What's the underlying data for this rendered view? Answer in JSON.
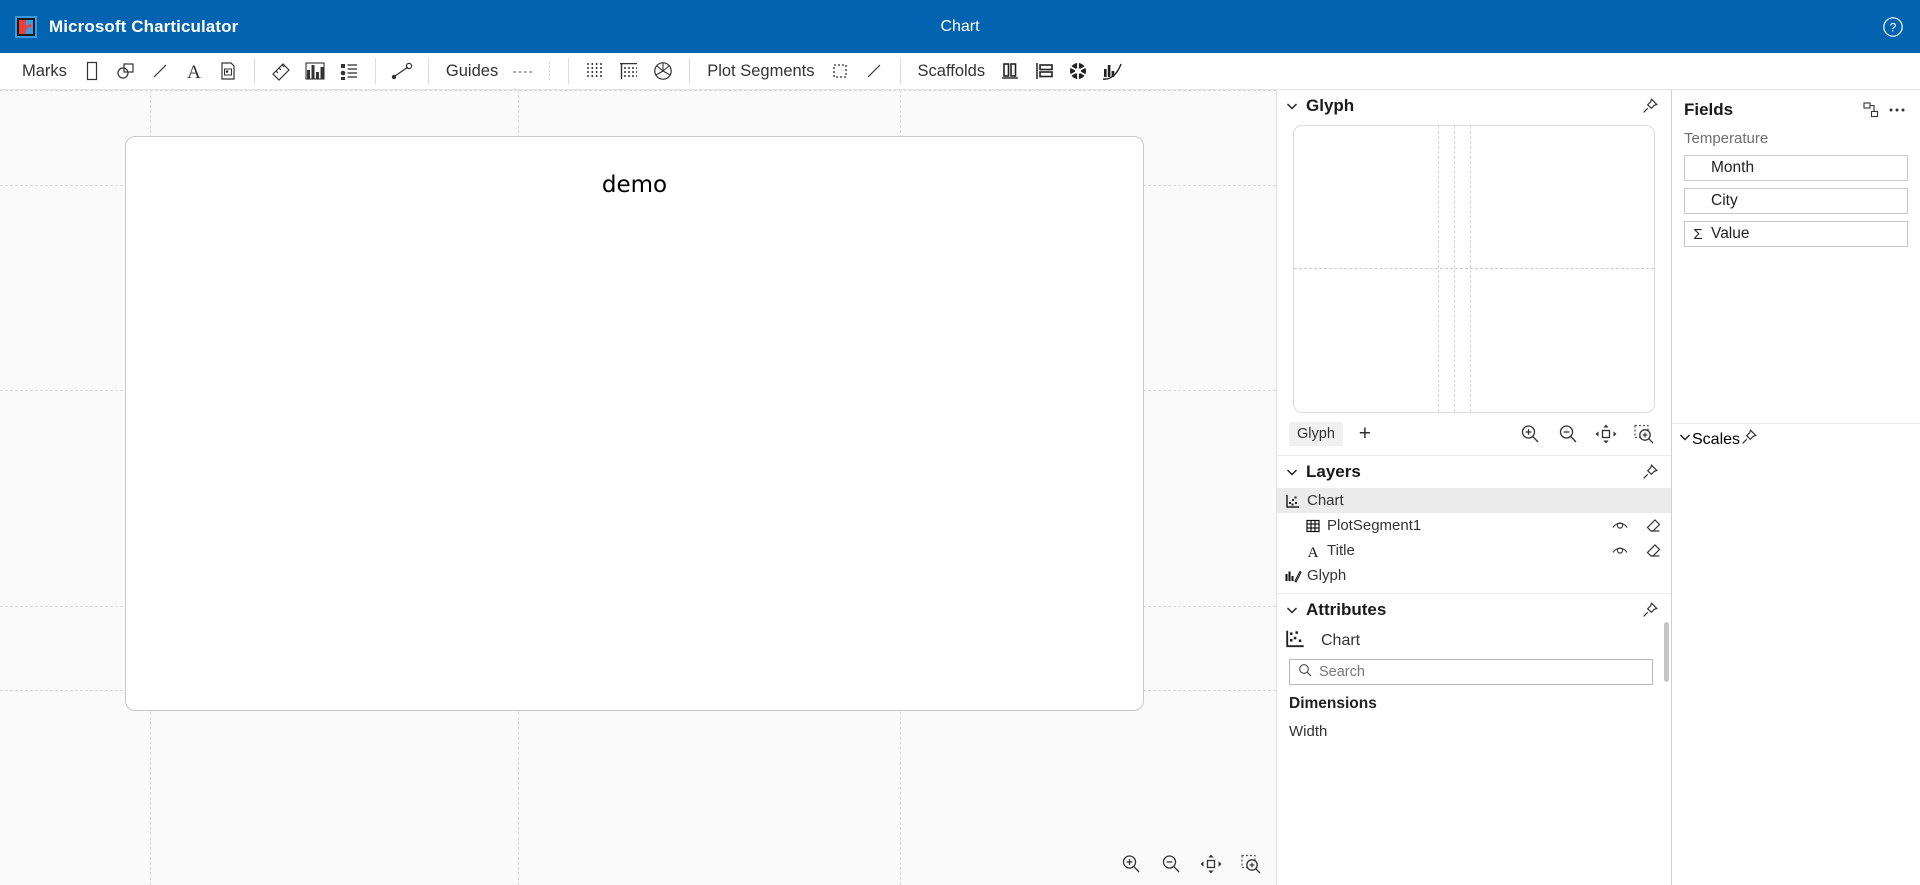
{
  "app": {
    "name": "Microsoft Charticulator",
    "logo_icon": "charticulator-logo",
    "center_title": "Chart",
    "help_icon": "help-circle-icon"
  },
  "toolbar": {
    "groups": [
      {
        "label": "Marks",
        "items": [
          {
            "icon": "rectangle-mark-icon",
            "name": "mark-rectangle"
          },
          {
            "icon": "symbol-mark-icon",
            "name": "mark-symbol"
          },
          {
            "icon": "line-mark-icon",
            "name": "mark-line"
          },
          {
            "icon": "text-mark-icon",
            "name": "mark-text"
          },
          {
            "icon": "image-mark-icon",
            "name": "mark-image"
          }
        ]
      },
      {
        "label": "",
        "items": [
          {
            "icon": "ruler-icon",
            "name": "mark-data-axis"
          },
          {
            "icon": "nested-chart-icon",
            "name": "mark-nested-chart"
          },
          {
            "icon": "legend-icon",
            "name": "mark-legend"
          }
        ]
      },
      {
        "label": "",
        "items": [
          {
            "icon": "link-icon",
            "name": "mark-link"
          }
        ]
      },
      {
        "label": "Guides",
        "items": [
          {
            "icon": "guide-line-icon",
            "name": "guide-line"
          },
          {
            "icon": "guide-coordinator-icon",
            "name": "guide-coordinator"
          }
        ]
      },
      {
        "label": "",
        "items": [
          {
            "icon": "guide-x-icon",
            "name": "guide-x"
          },
          {
            "icon": "guide-y-icon",
            "name": "guide-y"
          },
          {
            "icon": "guide-polar-icon",
            "name": "guide-polar"
          }
        ]
      },
      {
        "label": "Plot Segments",
        "items": [
          {
            "icon": "plot-segment-region-icon",
            "name": "plot-segment-2d"
          },
          {
            "icon": "plot-segment-line-icon",
            "name": "plot-segment-line"
          }
        ]
      },
      {
        "label": "Scaffolds",
        "items": [
          {
            "icon": "scaffold-cartesian-x-icon",
            "name": "scaffold-cartesian-x"
          },
          {
            "icon": "scaffold-cartesian-y-icon",
            "name": "scaffold-cartesian-y"
          },
          {
            "icon": "scaffold-polar-icon",
            "name": "scaffold-polar"
          },
          {
            "icon": "scaffold-curve-icon",
            "name": "scaffold-curve"
          }
        ]
      }
    ]
  },
  "canvas": {
    "chart_title": "demo",
    "zoom_controls": [
      {
        "icon": "zoom-in-icon",
        "name": "canvas-zoom-in"
      },
      {
        "icon": "zoom-out-icon",
        "name": "canvas-zoom-fit"
      },
      {
        "icon": "fit-screen-icon",
        "name": "canvas-fit-screen"
      },
      {
        "icon": "zoom-selection-icon",
        "name": "canvas-zoom-selection"
      }
    ]
  },
  "glyph_panel": {
    "title": "Glyph",
    "collapse_icon": "chevron-down-icon",
    "pin_icon": "pin-icon",
    "tab_label": "Glyph",
    "add_label": "+",
    "zoom_controls": [
      {
        "icon": "zoom-in-icon",
        "name": "glyph-zoom-in"
      },
      {
        "icon": "zoom-out-icon",
        "name": "glyph-zoom-out"
      },
      {
        "icon": "fit-screen-icon",
        "name": "glyph-fit-screen"
      },
      {
        "icon": "zoom-selection-icon",
        "name": "glyph-zoom-selection"
      }
    ]
  },
  "layers_panel": {
    "title": "Layers",
    "collapse_icon": "chevron-down-icon",
    "pin_icon": "pin-icon",
    "items": [
      {
        "label": "Chart",
        "icon": "chart-icon",
        "selected": true,
        "indent": false,
        "actions": []
      },
      {
        "label": "PlotSegment1",
        "icon": "plot-segment-icon",
        "selected": false,
        "indent": true,
        "actions": [
          "visibility-icon",
          "eraser-icon"
        ]
      },
      {
        "label": "Title",
        "icon": "text-icon",
        "selected": false,
        "indent": true,
        "actions": [
          "visibility-icon",
          "eraser-icon"
        ]
      },
      {
        "label": "Glyph",
        "icon": "glyph-icon",
        "selected": false,
        "indent": false,
        "actions": []
      }
    ]
  },
  "attributes_panel": {
    "title": "Attributes",
    "collapse_icon": "chevron-down-icon",
    "pin_icon": "pin-icon",
    "object_name": "Chart",
    "object_icon": "chart-icon",
    "search_placeholder": "Search",
    "search_value": "",
    "search_icon": "search-icon",
    "groups": [
      {
        "label": "Dimensions",
        "fields": [
          "Width"
        ]
      }
    ]
  },
  "fields_panel": {
    "title": "Fields",
    "dataset_name": "Temperature",
    "toolbar_icons": [
      {
        "icon": "link-table-icon",
        "name": "fields-link-table"
      },
      {
        "icon": "ellipsis-icon",
        "name": "fields-more-options"
      }
    ],
    "fields": [
      {
        "label": "Month",
        "agg_icon": ""
      },
      {
        "label": "City",
        "agg_icon": ""
      },
      {
        "label": "Value",
        "agg_icon": "Σ"
      }
    ]
  },
  "scales_panel": {
    "title": "Scales",
    "collapse_icon": "chevron-down-icon",
    "pin_icon": "pin-icon"
  },
  "colors": {
    "brand_blue": "#0263b0",
    "accent_orange": "#c56a1b",
    "canvas_bg": "#fafafa",
    "panel_border": "#e0e0e0"
  }
}
